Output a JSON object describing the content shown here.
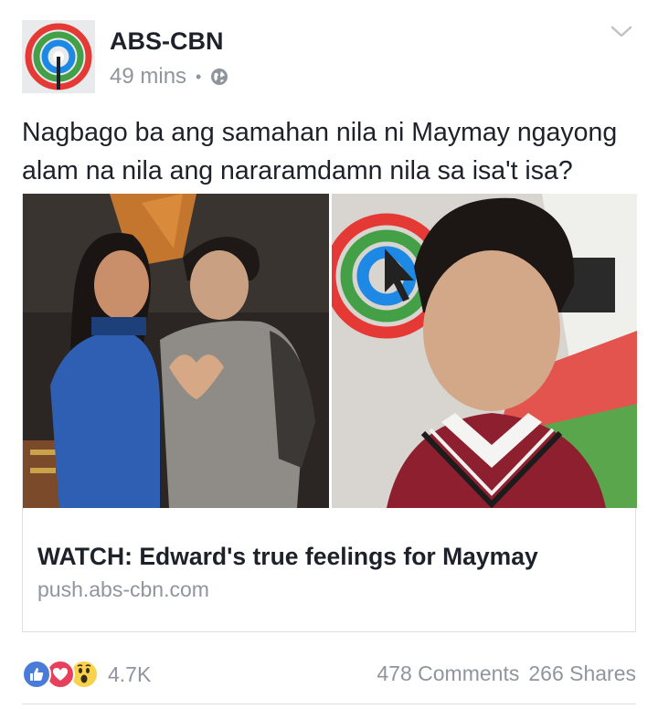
{
  "post": {
    "page_name": "ABS-CBN",
    "time": "49 mins",
    "separator": "•",
    "privacy_icon": "globe-icon",
    "text": "Nagbago ba ang samahan nila ni Maymay ngayong alam na nila ang nararamdamn nila sa isa't isa?"
  },
  "link_card": {
    "title": "WATCH: Edward's true feelings for Maymay",
    "domain": "push.abs-cbn.com",
    "images": [
      "couple-heart-photo",
      "boy-closeup-photo"
    ]
  },
  "footer": {
    "reactions": [
      "like-icon",
      "love-icon",
      "wow-icon"
    ],
    "reaction_count": "4.7K",
    "comments": "478 Comments",
    "shares": "266 Shares"
  },
  "colors": {
    "like": "#4a7bd8",
    "love": "#e8405a",
    "wow": "#f7d24c",
    "meta_text": "#90949c"
  }
}
